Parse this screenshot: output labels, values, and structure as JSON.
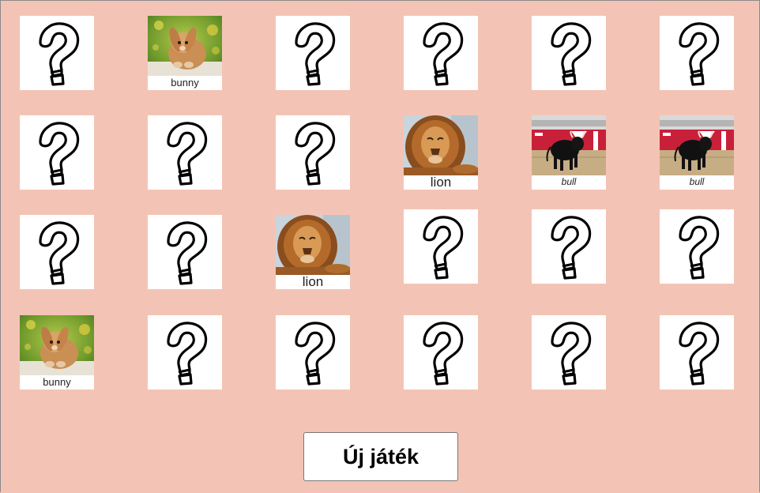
{
  "cards": [
    {
      "state": "hidden"
    },
    {
      "state": "revealed",
      "animal": "bunny",
      "label": "bunny"
    },
    {
      "state": "hidden"
    },
    {
      "state": "hidden"
    },
    {
      "state": "hidden"
    },
    {
      "state": "hidden"
    },
    {
      "state": "hidden"
    },
    {
      "state": "hidden"
    },
    {
      "state": "hidden"
    },
    {
      "state": "revealed",
      "animal": "lion",
      "label": "lion"
    },
    {
      "state": "revealed",
      "animal": "bull",
      "label": "bull"
    },
    {
      "state": "revealed",
      "animal": "bull",
      "label": "bull"
    },
    {
      "state": "hidden"
    },
    {
      "state": "hidden"
    },
    {
      "state": "revealed",
      "animal": "lion",
      "label": "lion"
    },
    {
      "state": "hidden"
    },
    {
      "state": "hidden"
    },
    {
      "state": "hidden"
    },
    {
      "state": "revealed",
      "animal": "bunny",
      "label": "bunny"
    },
    {
      "state": "hidden"
    },
    {
      "state": "hidden"
    },
    {
      "state": "hidden"
    },
    {
      "state": "hidden"
    },
    {
      "state": "hidden"
    }
  ],
  "new_game_label": "Új játék",
  "colors": {
    "background": "#f3c4b5",
    "card": "#ffffff"
  }
}
